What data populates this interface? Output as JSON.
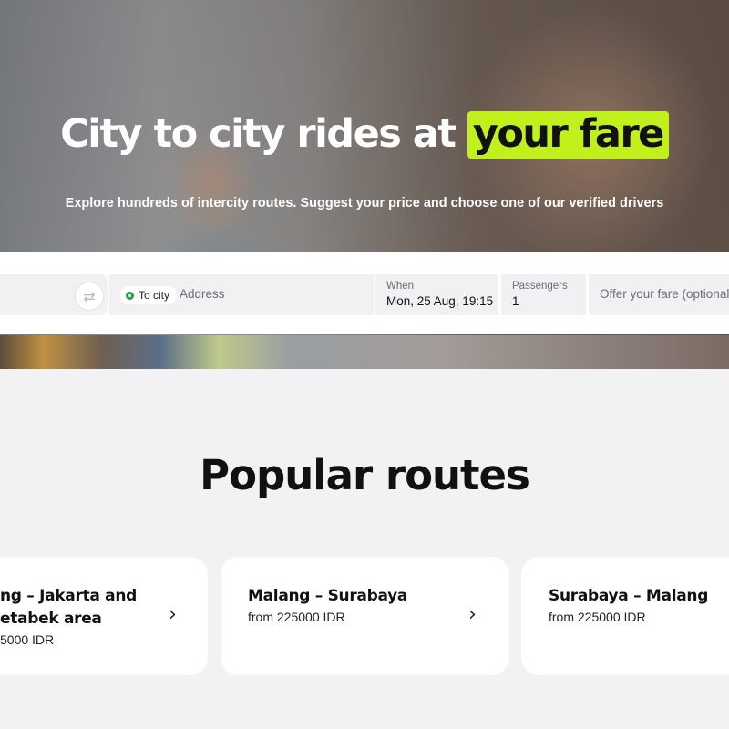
{
  "hero": {
    "title_main": "City to city rides at ",
    "title_highlight": "your fare",
    "subtitle": "Explore hundreds of intercity routes. Suggest your price and choose one of our verified drivers",
    "accent_color": "#c1f11d"
  },
  "search": {
    "swap_icon": "⇄",
    "to_pill_label": "To city",
    "to_placeholder": "Address",
    "when_label": "When",
    "when_value": "Mon, 25 Aug, 19:15",
    "passengers_label": "Passengers",
    "passengers_value": "1",
    "fare_placeholder": "Offer your fare (optional)"
  },
  "popular": {
    "title": "Popular routes",
    "routes": [
      {
        "line1": "ng – Jakarta and",
        "line2": "etabek area",
        "price": "5000 IDR"
      },
      {
        "line1": "Malang – Surabaya",
        "price": "from 225000 IDR"
      },
      {
        "line1": "Surabaya – Malang",
        "price": "from 225000 IDR"
      }
    ],
    "chevron_icon": "›"
  }
}
